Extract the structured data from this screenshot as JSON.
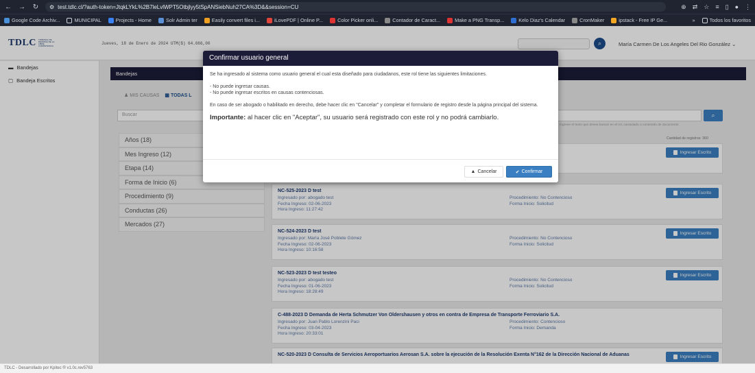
{
  "browser": {
    "url": "test.tdlc.cl/?auth-token=JtqkLYkL%2B7leLvlWPT5Otbjlyy5tSpANSiebNuh27CA%3D&&session=CU",
    "bookmarks": [
      "Google Code Archiv...",
      "MUNICIPAL",
      "Projects - Home",
      "Solr Admin ter",
      "Easily convert files i...",
      "iLovePDF | Online P...",
      "Color Picker onli...",
      "Contador de Caract...",
      "Make a PNG Transp...",
      "Kelo Diaz's Calendar",
      "CronMaker",
      "ipstack - Free IP Ge..."
    ],
    "bookmarks_more": "»",
    "all_bookmarks": "Todos los favoritos",
    "colors": {
      "chrome": "#1f2430",
      "url_bar": "#2b313d"
    }
  },
  "header": {
    "logo": "TDLC",
    "logo_sub": "TRIBUNAL DE DEFENSA DE LA LIBRE COMPETENCIA",
    "date": "Jueves, 18 de Enero de 2024   UTM($) 64.666,00",
    "user": "María Carmen De Los Angeles Del Rio González  ⌄"
  },
  "sidebar": {
    "items": [
      {
        "icon": "tray-icon",
        "label": "Bandejas"
      },
      {
        "icon": "box-icon",
        "label": "Bandeja Escritos"
      }
    ]
  },
  "main": {
    "section_title": "Bandejas",
    "tabs": [
      "MIS CAUSAS",
      "TODAS L"
    ],
    "search_placeholder": "Buscar",
    "search_hint": "Ingrese el texto que desea buscar en el rol, caratulado o contenido de documento",
    "count": "Cantidad de registros: 360",
    "filters": [
      "Años (18)",
      "Mes Ingreso (12)",
      "Etapa (14)",
      "Forma de Inicio (6)",
      "Procedimiento (9)",
      "Conductas (26)",
      "Mercados (27)"
    ],
    "button_label": "Ingresar Escrito",
    "cards": [
      {
        "title": "",
        "l1": "",
        "l2": "",
        "l3": "",
        "r1": "ntencioso",
        "r2": "",
        "has_button": true
      },
      {
        "title": "NC-525-2023 D test",
        "l1": "Ingresado por: abogado test",
        "l2": "Fecha Ingreso: 02-06-2023",
        "l3": "Hora Ingreso: 11:27:42",
        "r1": "Procedimiento: No Contencioso",
        "r2": "Forma Inicio: Solicitud",
        "has_button": true
      },
      {
        "title": "NC-524-2023 D test",
        "l1": "Ingresado por: María José Poblete Gómez",
        "l2": "Fecha Ingreso: 02-06-2023",
        "l3": "Hora Ingreso: 10:16:58",
        "r1": "Procedimiento: No Contencioso",
        "r2": "Forma Inicio: Solicitud",
        "has_button": true
      },
      {
        "title": "NC-523-2023 D test testeo",
        "l1": "Ingresado por: abogado test",
        "l2": "Fecha Ingreso: 01-06-2023",
        "l3": "Hora Ingreso: 18:28:49",
        "r1": "Procedimiento: No Contencioso",
        "r2": "Forma Inicio: Solicitud",
        "has_button": true
      },
      {
        "title": "C-488-2023 D Demanda de Herta Schmutzer Von Oldershausen y otros en contra de Empresa de Transporte Ferroviario S.A.",
        "l1": "Ingresado por: Juan Pablo Lorenzini Paci",
        "l2": "Fecha Ingreso: 03-04-2023",
        "l3": "Hora Ingreso: 20:33:01",
        "r1": "Procedimiento: Contencioso",
        "r2": "Forma Inicio: Demanda",
        "has_button": false
      },
      {
        "title": "NC-520-2023 D Consulta de Servicios Aeroportuarios Aerosan S.A. sobre la ejecución de la Resolución Exenta N°162 de la Dirección Nacional de Aduanas",
        "l1": "",
        "l2": "",
        "l3": "",
        "r1": "",
        "r2": "",
        "has_button": true
      }
    ]
  },
  "modal": {
    "title": "Confirmar usuario general",
    "intro": "Se ha ingresado al sistema como usuario general el cual esta diseñado para ciudadanos, este rol tiene las siguientes limitaciones.",
    "limit1": "- No puede ingresar causas.",
    "limit2": "- No puede ingresar escritos en causas contenciosas.",
    "instructions": "En caso de ser abogado o habilitado en derecho, debe hacer clic en \"Cancelar\" y completar el formulario de registro desde la página principal del sistema.",
    "important_label": "Importante:",
    "important_text": " al hacer clic en \"Aceptar\", su usuario será registrado con este rol y no podrá cambiarlo.",
    "cancel": "Cancelar",
    "confirm": "Confirmar"
  },
  "footer": {
    "text": "TDLC - Desarrollado por Kpitec ® v1.0c.rev5763"
  }
}
